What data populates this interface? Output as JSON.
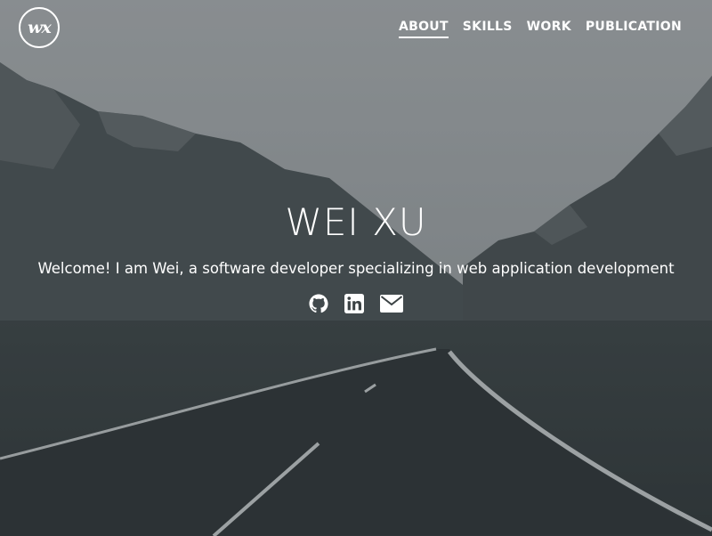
{
  "brand": {
    "logo_text": "wx"
  },
  "nav": {
    "items": [
      {
        "label": "ABOUT",
        "active": true
      },
      {
        "label": "SKILLS",
        "active": false
      },
      {
        "label": "WORK",
        "active": false
      },
      {
        "label": "PUBLICATION",
        "active": false
      }
    ]
  },
  "hero": {
    "name": "WEI XU",
    "tagline": "Welcome! I am Wei, a software developer specializing in web application development"
  },
  "social": [
    {
      "icon": "github-icon"
    },
    {
      "icon": "linkedin-icon"
    },
    {
      "icon": "envelope-icon"
    }
  ],
  "colors": {
    "text": "#ffffff",
    "overlay": "#3a4143"
  }
}
